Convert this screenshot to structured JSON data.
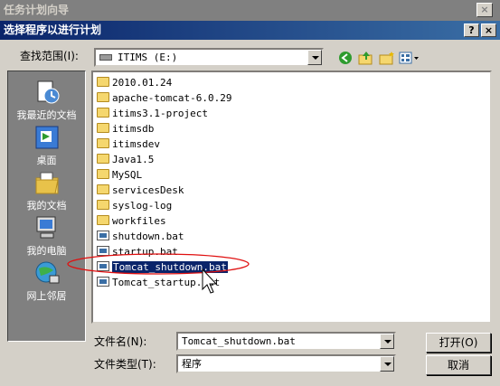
{
  "background_window": {
    "title": "任务计划向导",
    "close": "×"
  },
  "dialog": {
    "title": "选择程序以进行计划",
    "help": "?",
    "close": "×"
  },
  "lookin": {
    "label": "查找范围(I):",
    "value": "ITIMS (E:)"
  },
  "toolbar": {
    "back_icon": "back-icon",
    "up_icon": "up-folder-icon",
    "newfolder_icon": "new-folder-icon",
    "view_icon": "view-menu-icon"
  },
  "places": [
    {
      "label": "我最近的文档",
      "icon": "recent-icon"
    },
    {
      "label": "桌面",
      "icon": "desktop-icon"
    },
    {
      "label": "我的文档",
      "icon": "documents-icon"
    },
    {
      "label": "我的电脑",
      "icon": "computer-icon"
    },
    {
      "label": "网上邻居",
      "icon": "network-icon"
    }
  ],
  "files": [
    {
      "name": "2010.01.24",
      "type": "folder"
    },
    {
      "name": "apache-tomcat-6.0.29",
      "type": "folder"
    },
    {
      "name": "itims3.1-project",
      "type": "folder"
    },
    {
      "name": "itimsdb",
      "type": "folder"
    },
    {
      "name": "itimsdev",
      "type": "folder"
    },
    {
      "name": "Java1.5",
      "type": "folder"
    },
    {
      "name": "MySQL",
      "type": "folder"
    },
    {
      "name": "servicesDesk",
      "type": "folder"
    },
    {
      "name": "syslog-log",
      "type": "folder"
    },
    {
      "name": "workfiles",
      "type": "folder"
    },
    {
      "name": "shutdown.bat",
      "type": "bat"
    },
    {
      "name": "startup.bat",
      "type": "bat"
    },
    {
      "name": "Tomcat_shutdown.bat",
      "type": "bat",
      "selected": true
    },
    {
      "name": "Tomcat_startup.bat",
      "type": "bat"
    }
  ],
  "filename": {
    "label": "文件名(N):",
    "value": "Tomcat_shutdown.bat"
  },
  "filetype": {
    "label": "文件类型(T):",
    "value": "程序"
  },
  "buttons": {
    "open": "打开(O)",
    "cancel": "取消"
  },
  "annotation_color": "#e01010"
}
